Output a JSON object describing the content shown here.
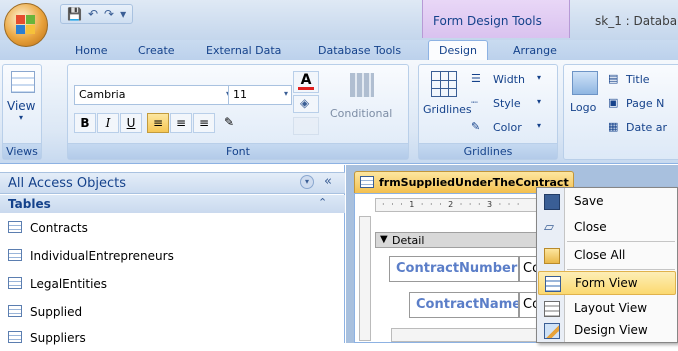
{
  "titlebar": {
    "context_tab_group": "Form Design Tools",
    "doc_title": "sk_1 : Databa"
  },
  "tabs": [
    "Home",
    "Create",
    "External Data",
    "Database Tools",
    "Design",
    "Arrange"
  ],
  "ribbon": {
    "views": {
      "view_label": "View",
      "group_label": "Views"
    },
    "font": {
      "font_name": "Cambria",
      "font_size": "11",
      "bold": "B",
      "italic": "I",
      "underline": "U",
      "group_label": "Font",
      "conditional": "Conditional"
    },
    "gridlines": {
      "gridlines_label": "Gridlines",
      "width_label": "Width",
      "style_label": "Style",
      "color_label": "Color",
      "group_label": "Gridlines"
    },
    "controls": {
      "logo_label": "Logo",
      "title_label": "Title",
      "pagen_label": "Page N",
      "datear_label": "Date ar"
    }
  },
  "nav": {
    "header": "All Access Objects",
    "collapse_glyph": "«",
    "group": "Tables",
    "items": [
      "Contracts",
      "IndividualEntrepreneurs",
      "LegalEntities",
      "Supplied",
      "Suppliers"
    ]
  },
  "document": {
    "tab_title": "frmSuppliedUnderTheContract",
    "ruler": "· · · 1 · · · 2 · · · 3 · · ·",
    "detail_label": "Detail",
    "fields": [
      {
        "label": "ContractNumber",
        "box": "Co"
      },
      {
        "label": "ContractName",
        "box": "Co"
      }
    ]
  },
  "context_menu": {
    "items": [
      "Save",
      "Close",
      "Close All",
      "Form View",
      "Layout View",
      "Design View"
    ]
  },
  "colors": {
    "accent": "#15428b",
    "highlight": "#fbd970",
    "context_tab": "#d9c2ef"
  }
}
